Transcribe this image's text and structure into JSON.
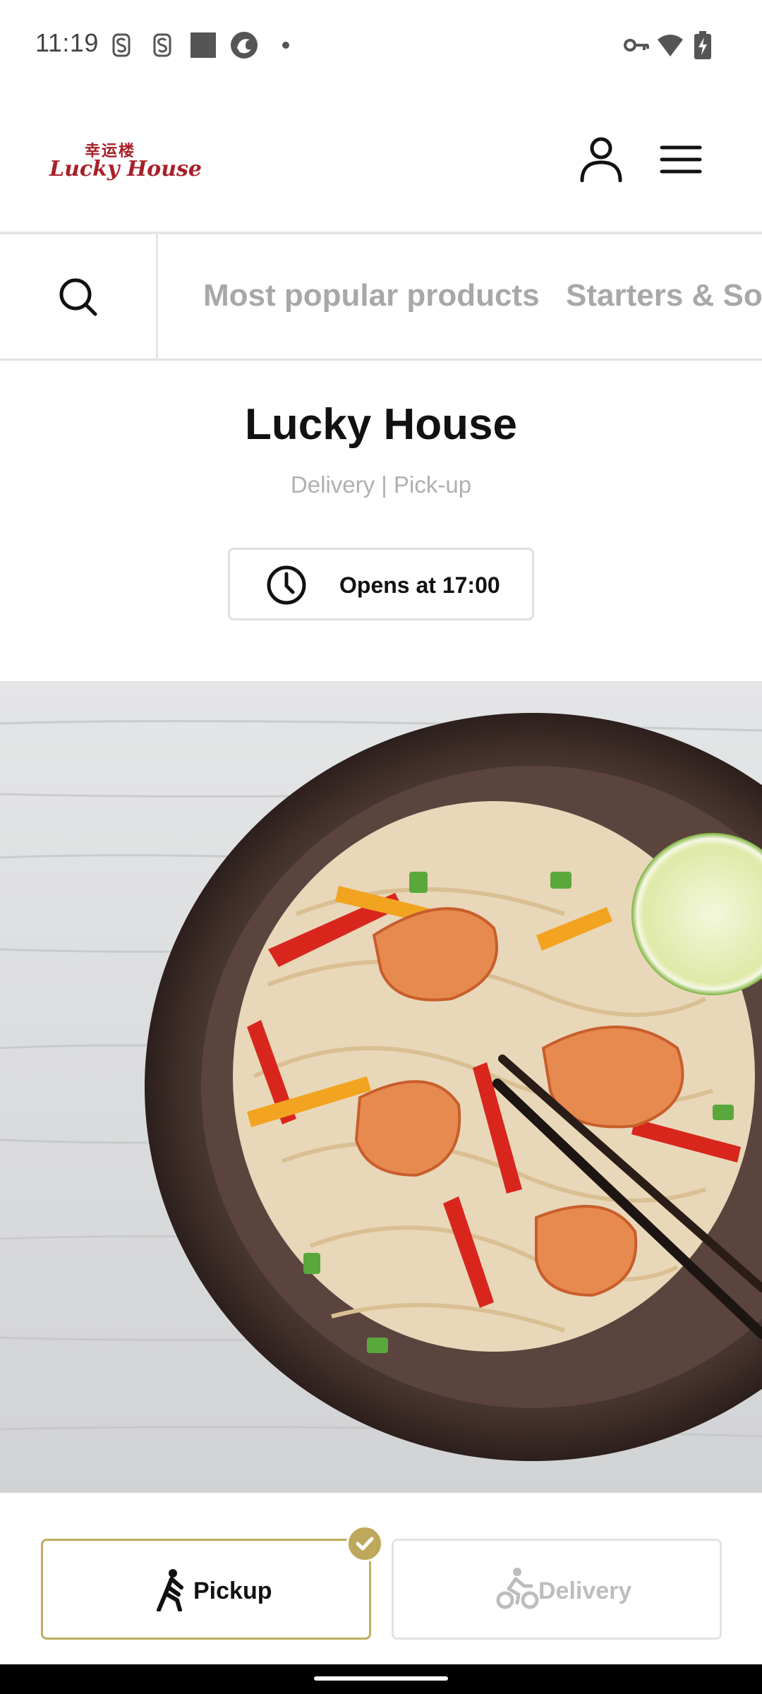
{
  "status_bar": {
    "time": "11:19",
    "icons": [
      "sim-s-icon",
      "sim-s-icon",
      "square-notification-icon",
      "app-notification-icon",
      "dot-icon",
      "vpn-key-icon",
      "wifi-icon",
      "battery-charging-icon"
    ]
  },
  "header": {
    "logo_cn": "幸运楼",
    "logo_en": "Lucky House",
    "icons": [
      "user-icon",
      "menu-icon"
    ]
  },
  "category_nav": {
    "search_icon": "search-icon",
    "items": [
      {
        "label": "Most popular products"
      },
      {
        "label": "Starters & So"
      }
    ]
  },
  "restaurant": {
    "name": "Lucky House",
    "subtitle": "Delivery | Pick-up",
    "hours_icon": "clock-icon",
    "hours_text": "Opens at 17:00"
  },
  "hero": {
    "image": "noodles-with-shrimp-photo"
  },
  "order_mode": {
    "options": [
      {
        "label": "Pickup",
        "icon": "walking-person-icon",
        "selected": true
      },
      {
        "label": "Delivery",
        "icon": "bicycle-courier-icon",
        "selected": false
      }
    ],
    "check_icon": "check-icon"
  },
  "colors": {
    "brand_red": "#a8202a",
    "accent_gold": "#bda85c",
    "muted_text": "#a8a8a8",
    "divider": "#e6e6e6"
  }
}
